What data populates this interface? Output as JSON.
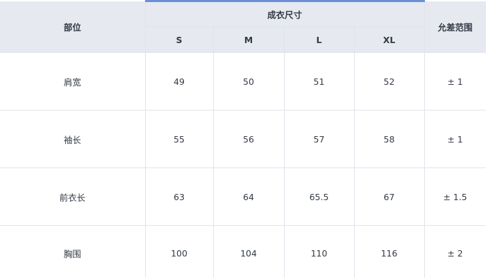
{
  "table": {
    "header": {
      "part_label": "部位",
      "group_label": "成衣尺寸",
      "tolerance_label": "允差范围",
      "sizes": [
        "S",
        "M",
        "L",
        "XL"
      ]
    },
    "rows": [
      {
        "part": "肩宽",
        "values": [
          "49",
          "50",
          "51",
          "52"
        ],
        "tolerance": "± 1"
      },
      {
        "part": "袖长",
        "values": [
          "55",
          "56",
          "57",
          "58"
        ],
        "tolerance": "± 1"
      },
      {
        "part": "前衣长",
        "values": [
          "63",
          "64",
          "65.5",
          "67"
        ],
        "tolerance": "± 1.5"
      },
      {
        "part": "胸围",
        "values": [
          "100",
          "104",
          "110",
          "116"
        ],
        "tolerance": "± 2"
      }
    ],
    "colors": {
      "header_bg": "#e6e9ef",
      "accent": "#6a8fd8",
      "border": "#dfe3ea",
      "text": "#333a45"
    }
  }
}
